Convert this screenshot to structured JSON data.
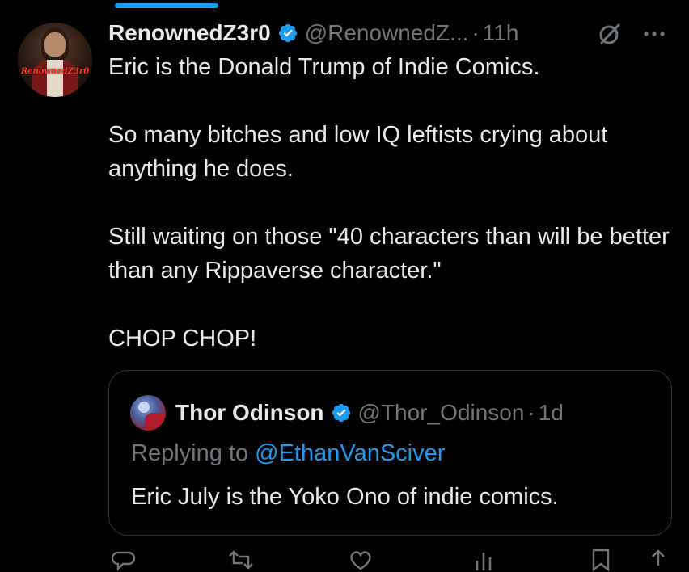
{
  "post": {
    "author_name": "RenownedZ3r0",
    "author_handle": "@RenownedZ...",
    "separator": "·",
    "time": "11h",
    "avatar_logo_text": "RenownedZ3r0",
    "body": [
      "Eric is the Donald Trump of Indie Comics.",
      "So many bitches and low IQ leftists crying about anything he does.",
      "Still waiting on those \"40 characters than will be better than any Rippaverse character.\"",
      "CHOP CHOP!"
    ]
  },
  "quote": {
    "author_name": "Thor Odinson",
    "author_handle": "@Thor_Odinson",
    "separator": "·",
    "time": "1d",
    "replying_prefix": "Replying to",
    "replying_mention": "@EthanVanSciver",
    "text": "Eric July is the Yoko Ono of indie comics."
  },
  "icons": {
    "verified": "verified-badge-icon",
    "grok": "grok-icon",
    "more": "more-options-icon",
    "reply": "reply-icon",
    "repost": "repost-icon",
    "like": "like-icon",
    "views": "views-icon",
    "bookmark": "bookmark-icon",
    "share": "share-icon"
  },
  "colors": {
    "background": "#000000",
    "text_primary": "#e7e9ea",
    "text_secondary": "#71767b",
    "accent": "#1d9bf0",
    "border": "#2f3336"
  }
}
